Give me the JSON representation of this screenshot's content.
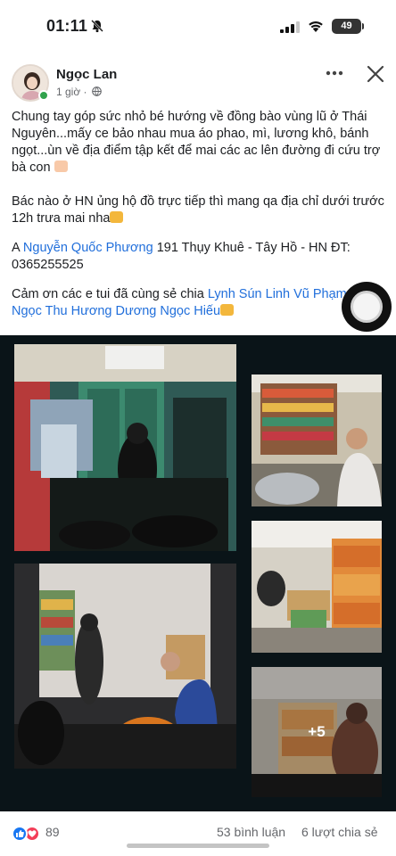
{
  "status_bar": {
    "time": "01:11",
    "battery": "49"
  },
  "post": {
    "author": "Ngọc Lan",
    "time_ago": "1 giờ ·",
    "paragraph1": "Chung tay góp sức nhỏ bé hướng về đồng bào vùng lũ ở Thái Nguyên...mấy ce bảo nhau mua áo phao, mì, lương khô, bánh ngọt...ùn về địa điểm tập kết để mai các ac lên đường đi cứu trợ bà con",
    "paragraph2": "Bác nào ở HN ủng hộ đồ trực tiếp thì mang qa địa chỉ dưới trước 12h trưa mai nha",
    "paragraph3_prefix": "A ",
    "paragraph3_tag": "Nguyễn Quốc Phương",
    "paragraph3_suffix": " 191 Thụy Khuê - Tây Hồ - HN  ĐT: 0365255525",
    "paragraph4_prefix": "Cảm ơn các e tui đã cùng sẻ chia ",
    "tags": [
      "Lynh Sún",
      "Linh Vũ",
      "Phạm Kim Ngọc",
      "Thu Hương",
      "Dương Ngọc Hiếu"
    ],
    "more_photos_label": "+5"
  },
  "footer": {
    "reactions": "89",
    "comments": "53 bình luận",
    "shares": "6 lượt chia sẻ"
  },
  "icons": {
    "bell": "bell-off-icon",
    "signal": "signal-icon",
    "wifi": "wifi-icon",
    "globe": "globe-icon",
    "more": "more-horizontal-icon",
    "close": "close-icon",
    "like": "like-reaction-icon",
    "love": "love-reaction-icon"
  },
  "colors": {
    "link": "#216fdb",
    "like": "#1877f2",
    "love": "#f33e58",
    "online": "#31a24c"
  }
}
